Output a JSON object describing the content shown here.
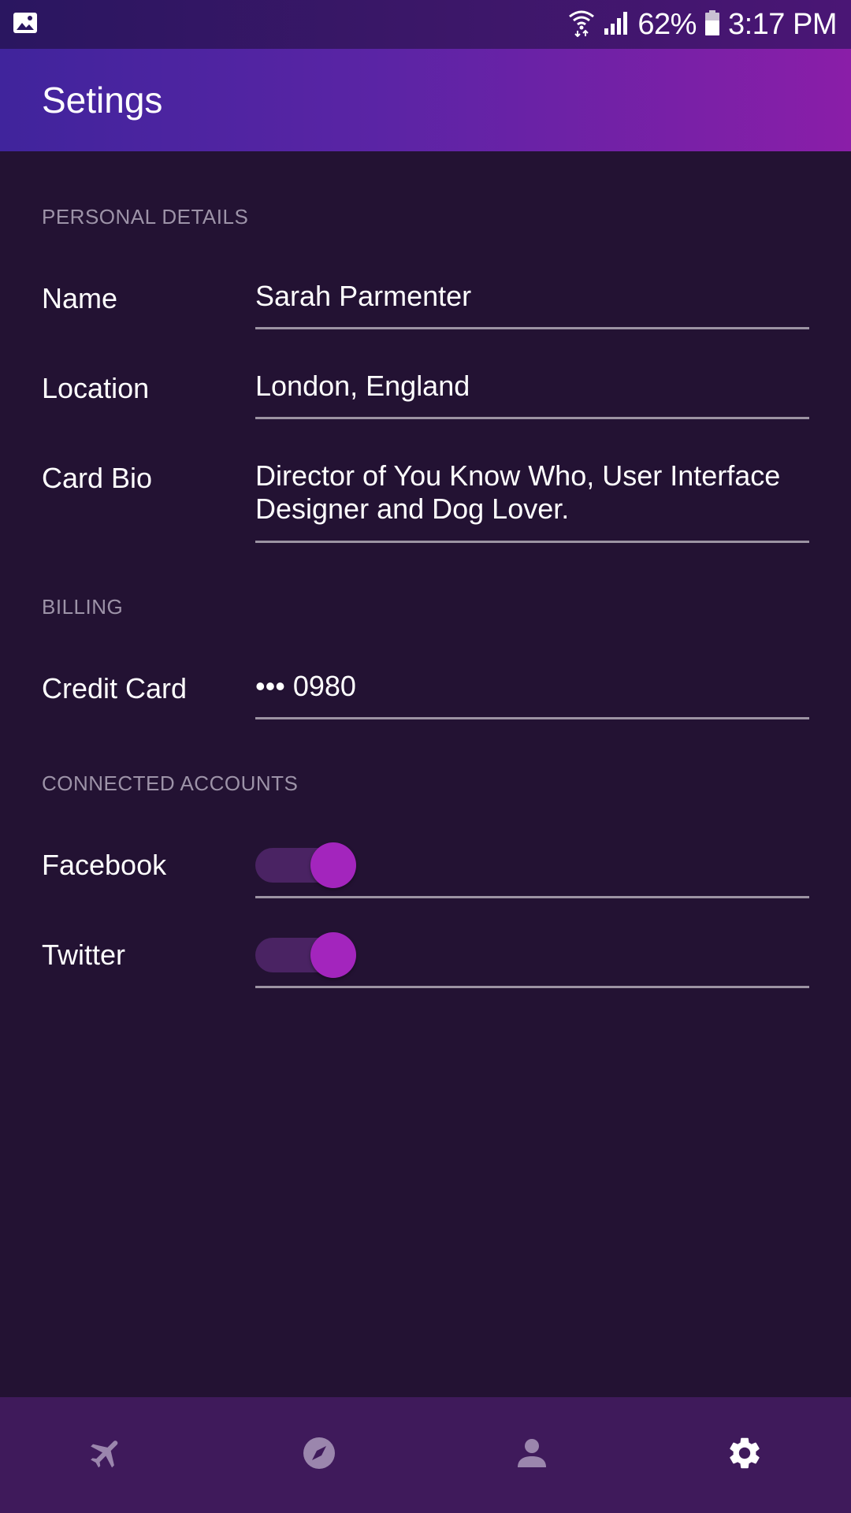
{
  "status_bar": {
    "battery": "62%",
    "time": "3:17 PM",
    "icons": [
      "image-icon",
      "wifi-icon",
      "signal-icon",
      "battery-icon"
    ]
  },
  "app_bar": {
    "title": "Setings"
  },
  "sections": {
    "personal": {
      "header": "PERSONAL DETAILS",
      "name_label": "Name",
      "name_value": "Sarah Parmenter",
      "location_label": "Location",
      "location_value": "London, England",
      "bio_label": "Card Bio",
      "bio_value": "Director of You Know Who, User Interface Designer and Dog Lover."
    },
    "billing": {
      "header": "BILLING",
      "card_label": "Credit Card",
      "card_value": "••• 0980"
    },
    "connected": {
      "header": "CONNECTED ACCOUNTS",
      "facebook_label": "Facebook",
      "facebook_enabled": true,
      "twitter_label": "Twitter",
      "twitter_enabled": true
    }
  },
  "bottom_nav": {
    "items": [
      {
        "icon": "airplane-icon",
        "active": false
      },
      {
        "icon": "compass-icon",
        "active": false
      },
      {
        "icon": "person-icon",
        "active": false
      },
      {
        "icon": "gear-icon",
        "active": true
      }
    ]
  },
  "colors": {
    "background": "#231233",
    "accent": "#a325bd",
    "nav_background": "#3f1a5b",
    "inactive_icon": "#9b86ad"
  }
}
